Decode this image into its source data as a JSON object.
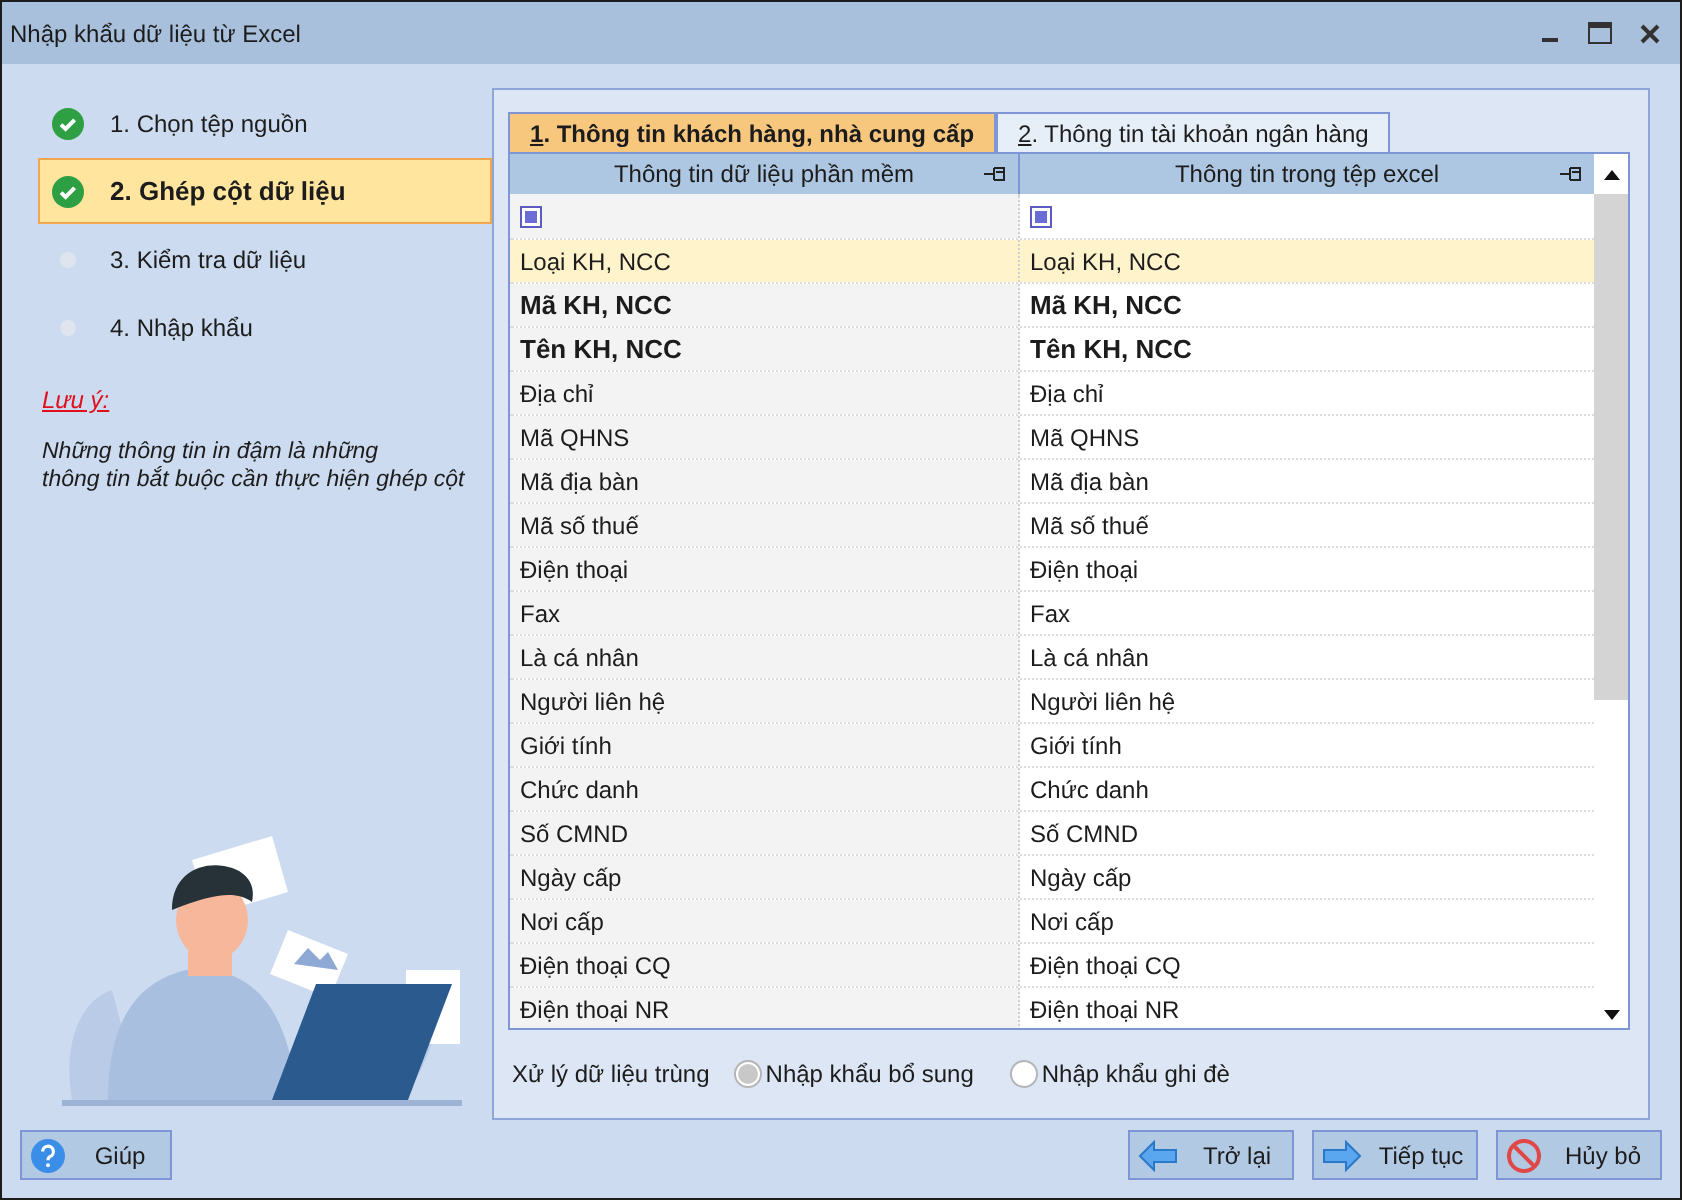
{
  "window": {
    "title": "Nhập khẩu dữ liệu từ Excel"
  },
  "steps": [
    {
      "label": "1. Chọn tệp nguồn",
      "done": true,
      "selected": false
    },
    {
      "label": "2. Ghép cột dữ liệu",
      "done": true,
      "selected": true
    },
    {
      "label": "3. Kiểm tra dữ liệu",
      "done": false,
      "selected": false
    },
    {
      "label": "4. Nhập khẩu",
      "done": false,
      "selected": false
    }
  ],
  "note": {
    "title": "Lưu ý:",
    "text": "Những thông tin in đậm là những\nthông tin bắt buộc cần thực hiện ghép cột"
  },
  "tabs": [
    {
      "key": "1",
      "label": ". Thông tin khách hàng, nhà cung cấp",
      "selected": true
    },
    {
      "key": "2",
      "label": ". Thông tin tài khoản ngân hàng",
      "selected": false
    }
  ],
  "table": {
    "columns": [
      "Thông tin dữ liệu phần mềm",
      "Thông tin trong tệp excel"
    ],
    "rows": [
      {
        "software": "Loại KH, NCC",
        "excel": "Loại KH, NCC",
        "required": false,
        "selected": true
      },
      {
        "software": "Mã KH, NCC",
        "excel": "Mã KH, NCC",
        "required": true,
        "selected": false
      },
      {
        "software": "Tên KH, NCC",
        "excel": "Tên KH, NCC",
        "required": true,
        "selected": false
      },
      {
        "software": "Địa chỉ",
        "excel": "Địa chỉ",
        "required": false,
        "selected": false
      },
      {
        "software": "Mã QHNS",
        "excel": "Mã QHNS",
        "required": false,
        "selected": false
      },
      {
        "software": "Mã địa bàn",
        "excel": "Mã địa bàn",
        "required": false,
        "selected": false
      },
      {
        "software": "Mã số thuế",
        "excel": "Mã số thuế",
        "required": false,
        "selected": false
      },
      {
        "software": "Điện thoại",
        "excel": "Điện thoại",
        "required": false,
        "selected": false
      },
      {
        "software": "Fax",
        "excel": "Fax",
        "required": false,
        "selected": false
      },
      {
        "software": "Là cá nhân",
        "excel": "Là cá nhân",
        "required": false,
        "selected": false
      },
      {
        "software": "Người liên hệ",
        "excel": "Người liên hệ",
        "required": false,
        "selected": false
      },
      {
        "software": "Giới tính",
        "excel": "Giới tính",
        "required": false,
        "selected": false
      },
      {
        "software": "Chức danh",
        "excel": "Chức danh",
        "required": false,
        "selected": false
      },
      {
        "software": "Số CMND",
        "excel": "Số CMND",
        "required": false,
        "selected": false
      },
      {
        "software": "Ngày cấp",
        "excel": "Ngày cấp",
        "required": false,
        "selected": false
      },
      {
        "software": "Nơi cấp",
        "excel": "Nơi cấp",
        "required": false,
        "selected": false
      },
      {
        "software": "Điện thoại CQ",
        "excel": "Điện thoại CQ",
        "required": false,
        "selected": false
      },
      {
        "software": "Điện thoại NR",
        "excel": "Điện thoại NR",
        "required": false,
        "selected": false
      }
    ]
  },
  "duplicate": {
    "label": "Xử lý dữ liệu trùng",
    "options": [
      {
        "label": "Nhập khẩu bổ sung",
        "selected": true
      },
      {
        "label": "Nhập khẩu ghi đè",
        "selected": false
      }
    ]
  },
  "buttons": [
    {
      "kind": "help",
      "label": "Giúp"
    },
    {
      "kind": "back",
      "label": "Trở lại"
    },
    {
      "kind": "next",
      "label": "Tiếp tục"
    },
    {
      "kind": "cancel",
      "label": "Hủy bỏ"
    }
  ]
}
